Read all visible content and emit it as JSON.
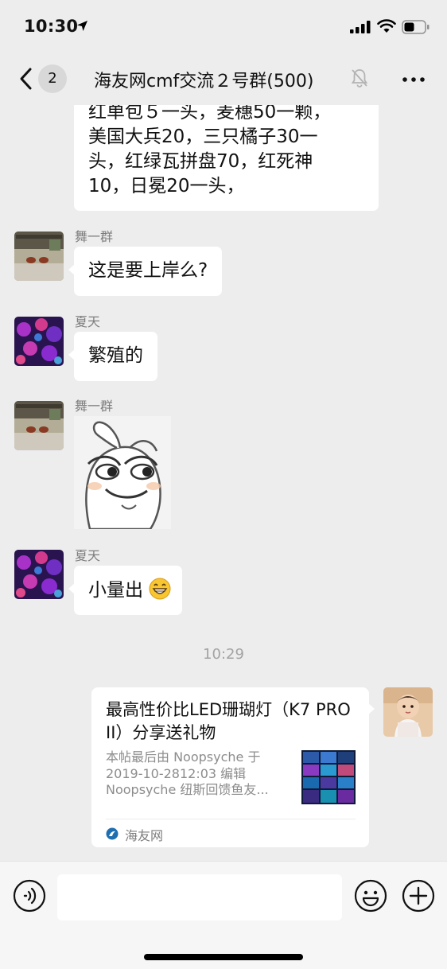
{
  "status_bar": {
    "time": "10:30"
  },
  "header": {
    "back_badge": "2",
    "title": "海友网cmf交流２号群(500)"
  },
  "messages": [
    {
      "direction": "incoming",
      "partial": true,
      "lines": [
        "红单包５一头，麦穗50一颗，",
        "美国大兵20，三只橘子30一",
        "头，红绿瓦拼盘70，红死神",
        "10，日冕20一头，"
      ]
    },
    {
      "direction": "incoming",
      "sender": "舞一群",
      "text": "这是要上岸么?"
    },
    {
      "direction": "incoming",
      "sender": "夏天",
      "text": "繁殖的"
    },
    {
      "direction": "incoming",
      "sender": "舞一群",
      "type": "sticker"
    },
    {
      "direction": "incoming",
      "sender": "夏天",
      "text": "小量出",
      "emoji": "grinning-face-icon"
    }
  ],
  "time_separator": "10:29",
  "link_card": {
    "title": "最高性价比LED珊瑚灯（K7 PRO II）分享送礼物",
    "desc_lines": [
      "本帖最后由 Noopsyche 于",
      "2019-10-2812:03 编辑",
      "Noopsyche 纽斯回馈鱼友..."
    ],
    "source": "海友网"
  },
  "input_bar": {
    "value": "",
    "placeholder": ""
  },
  "colors": {
    "background": "#ededed",
    "bubble": "#ffffff",
    "sender_text": "#7d7d7d",
    "time_text": "#a3a3a3"
  }
}
